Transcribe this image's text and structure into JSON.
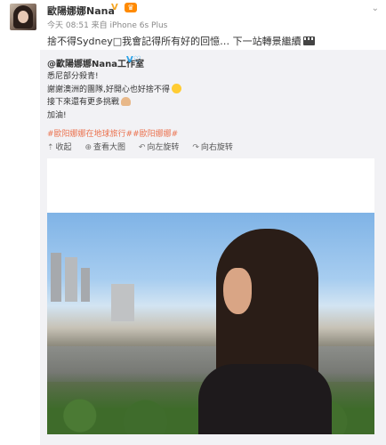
{
  "post": {
    "author": "歐陽娜娜Nana",
    "verified_badge": "V",
    "vip_icon": "vip-crown-icon",
    "meta": "今天 08:51 来自 iPhone 6s Plus",
    "text": "捨不得Sydney□我會記得所有好的回憶… 下一站轉景繼續",
    "text_icon": "film-clapper-icon"
  },
  "repost": {
    "author": "@歐陽娜娜Nana工作室",
    "badges": "V♡",
    "lines": [
      "悉尼部分殺青!",
      "謝謝澳洲的團隊,好開心也好捨不得",
      "接下來還有更多挑戰",
      "加油!"
    ],
    "tags": "#歐阳娜娜在地球旅行##歐阳娜娜#",
    "actions": [
      {
        "icon": "collapse-icon",
        "label": "收起"
      },
      {
        "icon": "zoom-icon",
        "label": "查看大图"
      },
      {
        "icon": "rotate-left-icon",
        "label": "向左旋转"
      },
      {
        "icon": "rotate-right-icon",
        "label": "向右旋转"
      }
    ]
  },
  "colors": {
    "tag": "#eb7350",
    "verified": "#f5a623",
    "repost_bg": "#f2f2f5"
  }
}
